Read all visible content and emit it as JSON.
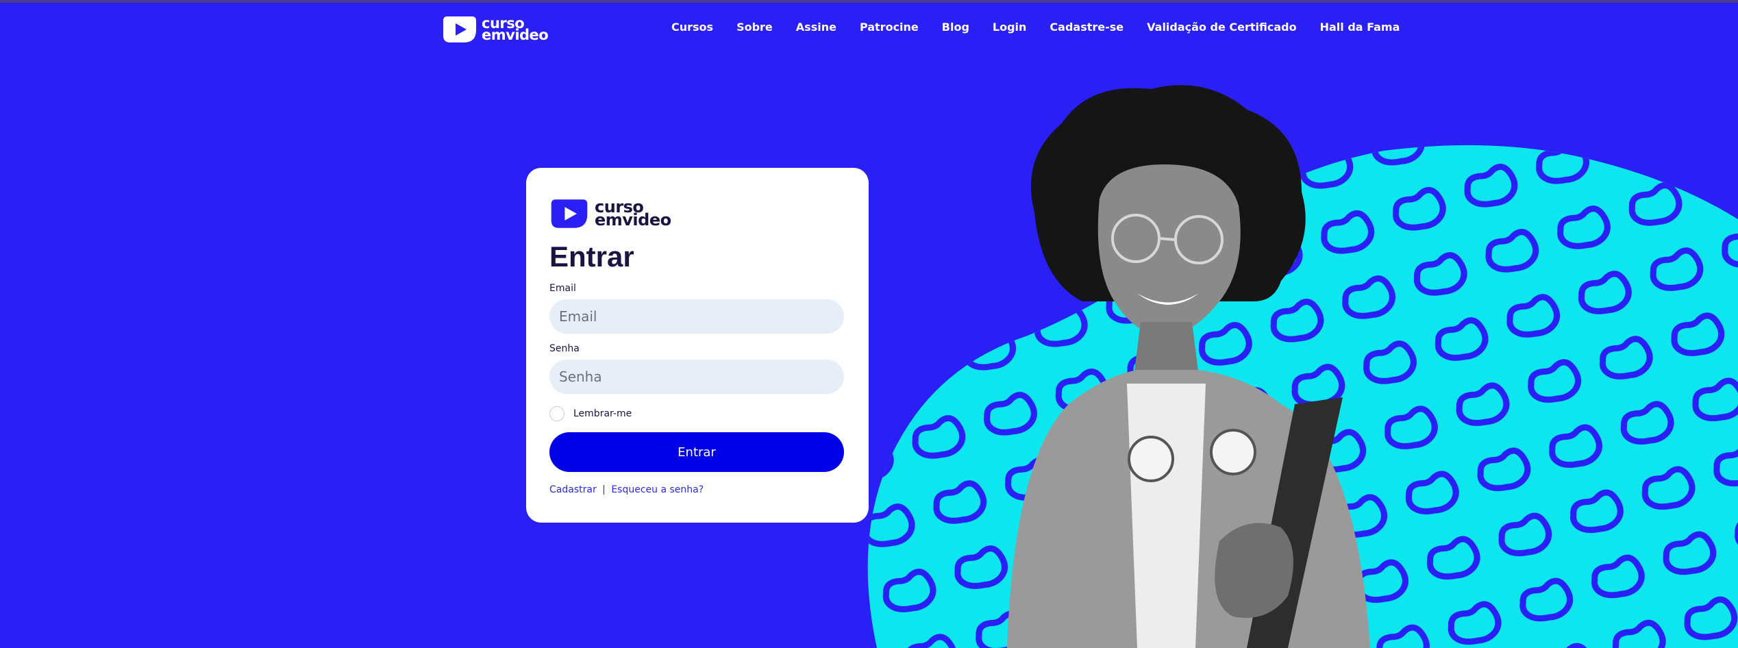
{
  "header": {
    "logo": {
      "line1": "curso",
      "line2": "emvideo"
    },
    "nav": [
      {
        "label": "Cursos"
      },
      {
        "label": "Sobre"
      },
      {
        "label": "Assine"
      },
      {
        "label": "Patrocine"
      },
      {
        "label": "Blog"
      },
      {
        "label": "Login"
      },
      {
        "label": "Cadastre-se"
      },
      {
        "label": "Validação de Certificado"
      },
      {
        "label": "Hall da Fama"
      }
    ]
  },
  "login": {
    "logo": {
      "line1": "curso",
      "line2": "emvideo"
    },
    "title": "Entrar",
    "email": {
      "label": "Email",
      "placeholder": "Email",
      "value": ""
    },
    "password": {
      "label": "Senha",
      "placeholder": "Senha",
      "value": ""
    },
    "remember_label": "Lembrar-me",
    "remember_checked": false,
    "submit_label": "Entrar",
    "links": {
      "register": "Cadastrar",
      "separator": "|",
      "forgot": "Esqueceu a senha?"
    }
  },
  "icons": {
    "logo": "play-button-logo-icon"
  },
  "colors": {
    "background": "#2a1ff5",
    "accent_cyan": "#0ee6ef",
    "button": "#0000e6",
    "text_dark": "#1b1342",
    "input_bg": "#e8eef8",
    "link": "#2a2ae0"
  }
}
